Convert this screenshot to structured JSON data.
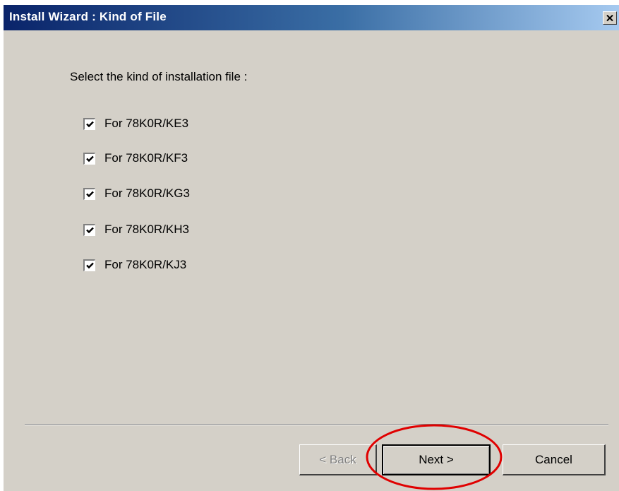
{
  "window": {
    "title": "Install Wizard : Kind of File"
  },
  "content": {
    "prompt": "Select the kind of installation file :",
    "options": [
      {
        "label": "For 78K0R/KE3",
        "checked": true
      },
      {
        "label": "For 78K0R/KF3",
        "checked": true
      },
      {
        "label": "For 78K0R/KG3",
        "checked": true
      },
      {
        "label": "For 78K0R/KH3",
        "checked": true
      },
      {
        "label": "For 78K0R/KJ3",
        "checked": true
      }
    ]
  },
  "buttons": {
    "back": "< Back",
    "next": "Next >",
    "cancel": "Cancel"
  },
  "annotation": {
    "highlight_color": "#e00000"
  },
  "icons": {
    "close": "close-icon",
    "check": "check-icon"
  }
}
